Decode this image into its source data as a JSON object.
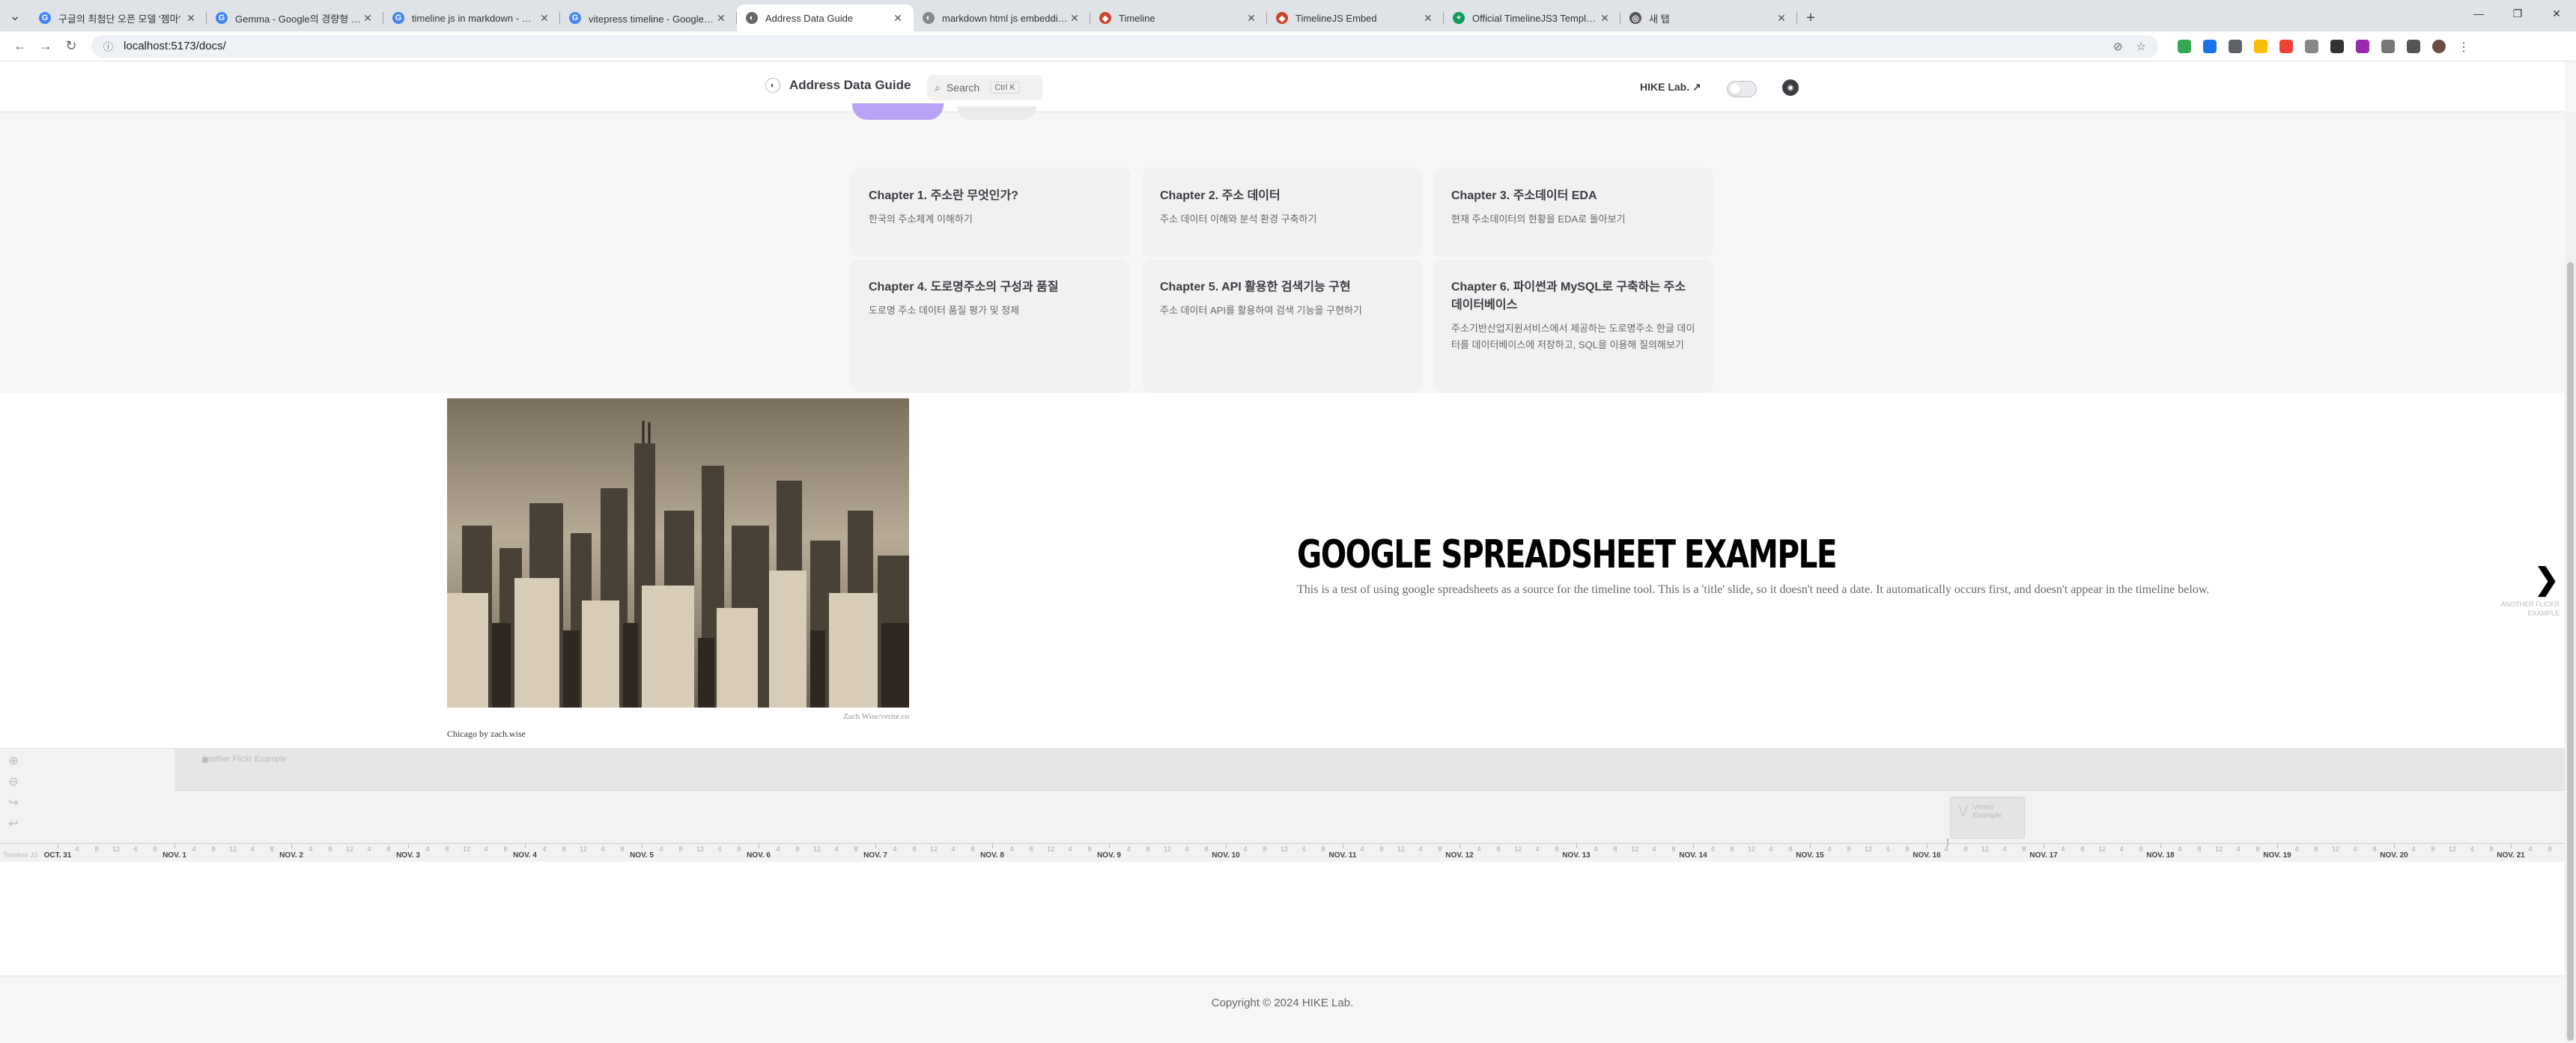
{
  "browser": {
    "tabs": [
      {
        "title": "구글의 최첨단 오픈 모델 '젬마'",
        "fav": "G",
        "color": "#4285f4"
      },
      {
        "title": "Gemma - Google의 경량형 첨단",
        "fav": "G",
        "color": "#4285f4"
      },
      {
        "title": "timeline js in markdown - Goo",
        "fav": "G",
        "color": "#4285f4"
      },
      {
        "title": "vitepress timeline - Google 검",
        "fav": "G",
        "color": "#4285f4"
      },
      {
        "title": "Address Data Guide",
        "fav": "◐",
        "color": "#666666"
      },
      {
        "title": "markdown html js embedding",
        "fav": "◐",
        "color": "#888888"
      },
      {
        "title": "Timeline",
        "fav": "◆",
        "color": "#c8452c"
      },
      {
        "title": "TimelineJS Embed",
        "fav": "◆",
        "color": "#c8452c"
      },
      {
        "title": "Official TimelineJS3 Template",
        "fav": "+",
        "color": "#0f9d58"
      },
      {
        "title": "새 탭",
        "fav": "◎",
        "color": "#555555"
      }
    ],
    "active_tab": 4,
    "url": "localhost:5173/docs/"
  },
  "nav": {
    "site_title": "Address Data Guide",
    "search_label": "Search",
    "search_shortcut": "Ctrl K",
    "link_label": "HIKE Lab. ↗"
  },
  "features": [
    {
      "title": "Chapter 1. 주소란 무엇인가?",
      "details": "한국의 주소체계 이해하기"
    },
    {
      "title": "Chapter 2. 주소 데이터",
      "details": "주소 데이터 이해와 분석 환경 구축하기"
    },
    {
      "title": "Chapter 3. 주소데이터 EDA",
      "details": "현재 주소데이터의 현황을 EDA로 돌아보기"
    },
    {
      "title": "Chapter 4. 도로명주소의 구성과 품질",
      "details": "도로명 주소 데이터 품질 평가 및 정제"
    },
    {
      "title": "Chapter 5. API 활용한 검색기능 구현",
      "details": "주소 데이터 API를 활용하여 검색 기능을 구현하기"
    },
    {
      "title": "Chapter 6. 파이썬과 MySQL로 구축하는 주소 데이터베이스",
      "details": "주소기반산업지원서비스에서 제공하는 도로명주소 한글 데이터를 데이터베이스에 저장하고, SQL을 이용해 질의해보기"
    }
  ],
  "timeline": {
    "credit": "Zach Wise/verite.co",
    "caption": "Chicago by zach.wise",
    "headline": "GOOGLE SPREADSHEET EXAMPLE",
    "text": "This is a test of using google spreadsheets as a source for the timeline tool. This is a 'title' slide, so it doesn't need a date. It automatically occurs first, and doesn't appear in the timeline below.",
    "next_label": "ANOTHER FLICKR EXAMPLE",
    "track_label": "Another Flickr Example",
    "marker_label": "Vimeo Example",
    "axis_first": "Timeline JS",
    "axis_majors": [
      "OCT. 31",
      "NOV. 1",
      "NOV. 2",
      "NOV. 3",
      "NOV. 4",
      "NOV. 5",
      "NOV. 6",
      "NOV. 7",
      "NOV. 8",
      "NOV. 9",
      "NOV. 10",
      "NOV. 11",
      "NOV. 12",
      "NOV. 13",
      "NOV. 14",
      "NOV. 15",
      "NOV. 16",
      "NOV. 17",
      "NOV. 18",
      "NOV. 19",
      "NOV. 20",
      "NOV. 21"
    ],
    "axis_minor": [
      "4",
      "8",
      "12",
      "4",
      "8"
    ]
  },
  "footer": {
    "copyright": "Copyright © 2024 HIKE Lab."
  }
}
